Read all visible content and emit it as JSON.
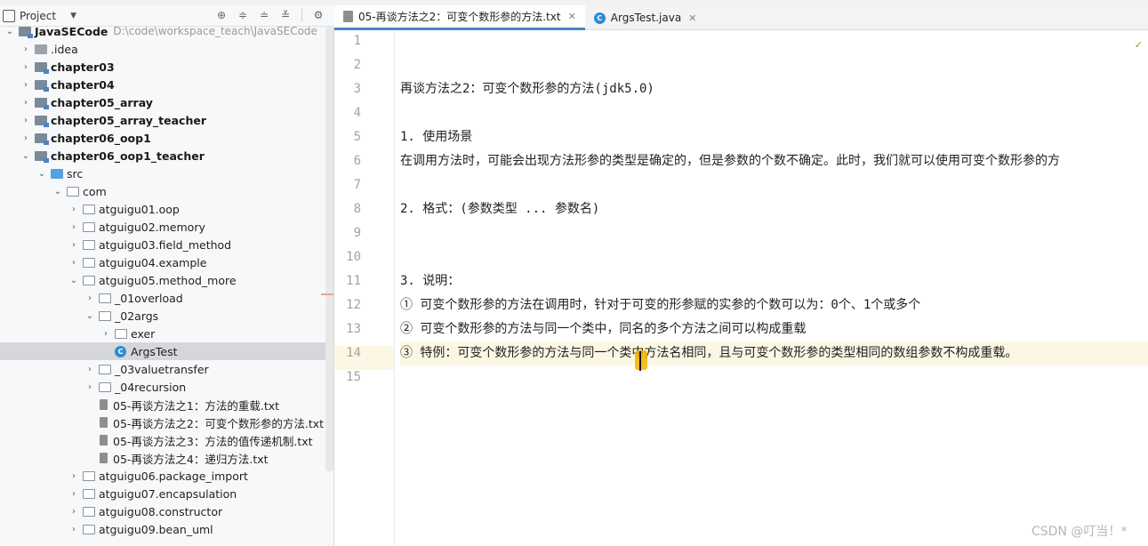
{
  "tabs": [
    {
      "label": "05-再谈方法之2：可变个数形参的方法.txt",
      "active": true,
      "type": "txt"
    },
    {
      "label": "ArgsTest.java",
      "active": false,
      "type": "java"
    }
  ],
  "project_panel": {
    "title": "Project",
    "tree": [
      {
        "label": "JavaSECode",
        "path": "D:\\code\\workspace_teach\\JavaSECode",
        "bold": true,
        "indent": 0,
        "arrow": "down",
        "icon": "module"
      },
      {
        "label": ".idea",
        "indent": 1,
        "arrow": "right",
        "icon": "plain"
      },
      {
        "label": "chapter03",
        "indent": 1,
        "arrow": "right",
        "icon": "module",
        "bold": true
      },
      {
        "label": "chapter04",
        "indent": 1,
        "arrow": "right",
        "icon": "module",
        "bold": true
      },
      {
        "label": "chapter05_array",
        "indent": 1,
        "arrow": "right",
        "icon": "module",
        "bold": true
      },
      {
        "label": "chapter05_array_teacher",
        "indent": 1,
        "arrow": "right",
        "icon": "module",
        "bold": true
      },
      {
        "label": "chapter06_oop1",
        "indent": 1,
        "arrow": "right",
        "icon": "module",
        "bold": true
      },
      {
        "label": "chapter06_oop1_teacher",
        "indent": 1,
        "arrow": "down",
        "icon": "module",
        "bold": true
      },
      {
        "label": "src",
        "indent": 2,
        "arrow": "down",
        "icon": "src"
      },
      {
        "label": "com",
        "indent": 3,
        "arrow": "down",
        "icon": "pkg"
      },
      {
        "label": "atguigu01.oop",
        "indent": 4,
        "arrow": "right",
        "icon": "pkg"
      },
      {
        "label": "atguigu02.memory",
        "indent": 4,
        "arrow": "right",
        "icon": "pkg"
      },
      {
        "label": "atguigu03.field_method",
        "indent": 4,
        "arrow": "right",
        "icon": "pkg"
      },
      {
        "label": "atguigu04.example",
        "indent": 4,
        "arrow": "right",
        "icon": "pkg"
      },
      {
        "label": "atguigu05.method_more",
        "indent": 4,
        "arrow": "down",
        "icon": "pkg"
      },
      {
        "label": "_01overload",
        "indent": 5,
        "arrow": "right",
        "icon": "pkg"
      },
      {
        "label": "_02args",
        "indent": 5,
        "arrow": "down",
        "icon": "pkg"
      },
      {
        "label": "exer",
        "indent": 6,
        "arrow": "right",
        "icon": "pkg"
      },
      {
        "label": "ArgsTest",
        "indent": 6,
        "arrow": "none",
        "icon": "class",
        "selected": true
      },
      {
        "label": "_03valuetransfer",
        "indent": 5,
        "arrow": "right",
        "icon": "pkg"
      },
      {
        "label": "_04recursion",
        "indent": 5,
        "arrow": "right",
        "icon": "pkg"
      },
      {
        "label": "05-再谈方法之1：方法的重载.txt",
        "indent": 5,
        "arrow": "none",
        "icon": "txt"
      },
      {
        "label": "05-再谈方法之2：可变个数形参的方法.txt",
        "indent": 5,
        "arrow": "none",
        "icon": "txt"
      },
      {
        "label": "05-再谈方法之3：方法的值传递机制.txt",
        "indent": 5,
        "arrow": "none",
        "icon": "txt"
      },
      {
        "label": "05-再谈方法之4：递归方法.txt",
        "indent": 5,
        "arrow": "none",
        "icon": "txt"
      },
      {
        "label": "atguigu06.package_import",
        "indent": 4,
        "arrow": "right",
        "icon": "pkg"
      },
      {
        "label": "atguigu07.encapsulation",
        "indent": 4,
        "arrow": "right",
        "icon": "pkg"
      },
      {
        "label": "atguigu08.constructor",
        "indent": 4,
        "arrow": "right",
        "icon": "pkg"
      },
      {
        "label": "atguigu09.bean_uml",
        "indent": 4,
        "arrow": "right",
        "icon": "pkg"
      }
    ]
  },
  "editor": {
    "current_line": 14,
    "lines": [
      "",
      "",
      "再谈方法之2：可变个数形参的方法(jdk5.0)",
      "",
      "1. 使用场景",
      "在调用方法时，可能会出现方法形参的类型是确定的，但是参数的个数不确定。此时，我们就可以使用可变个数形参的方",
      "",
      "2. 格式：(参数类型 ... 参数名)",
      "",
      "",
      "3. 说明：",
      "① 可变个数形参的方法在调用时，针对于可变的形参赋的实参的个数可以为：0个、1个或多个",
      "② 可变个数形参的方法与同一个类中，同名的多个方法之间可以构成重载",
      "③ 特例：可变个数形参的方法与同一个类中方法名相同，且与可变个数形参的类型相同的数组参数不构成重载。",
      ""
    ]
  },
  "watermark": "CSDN @叮当！*"
}
